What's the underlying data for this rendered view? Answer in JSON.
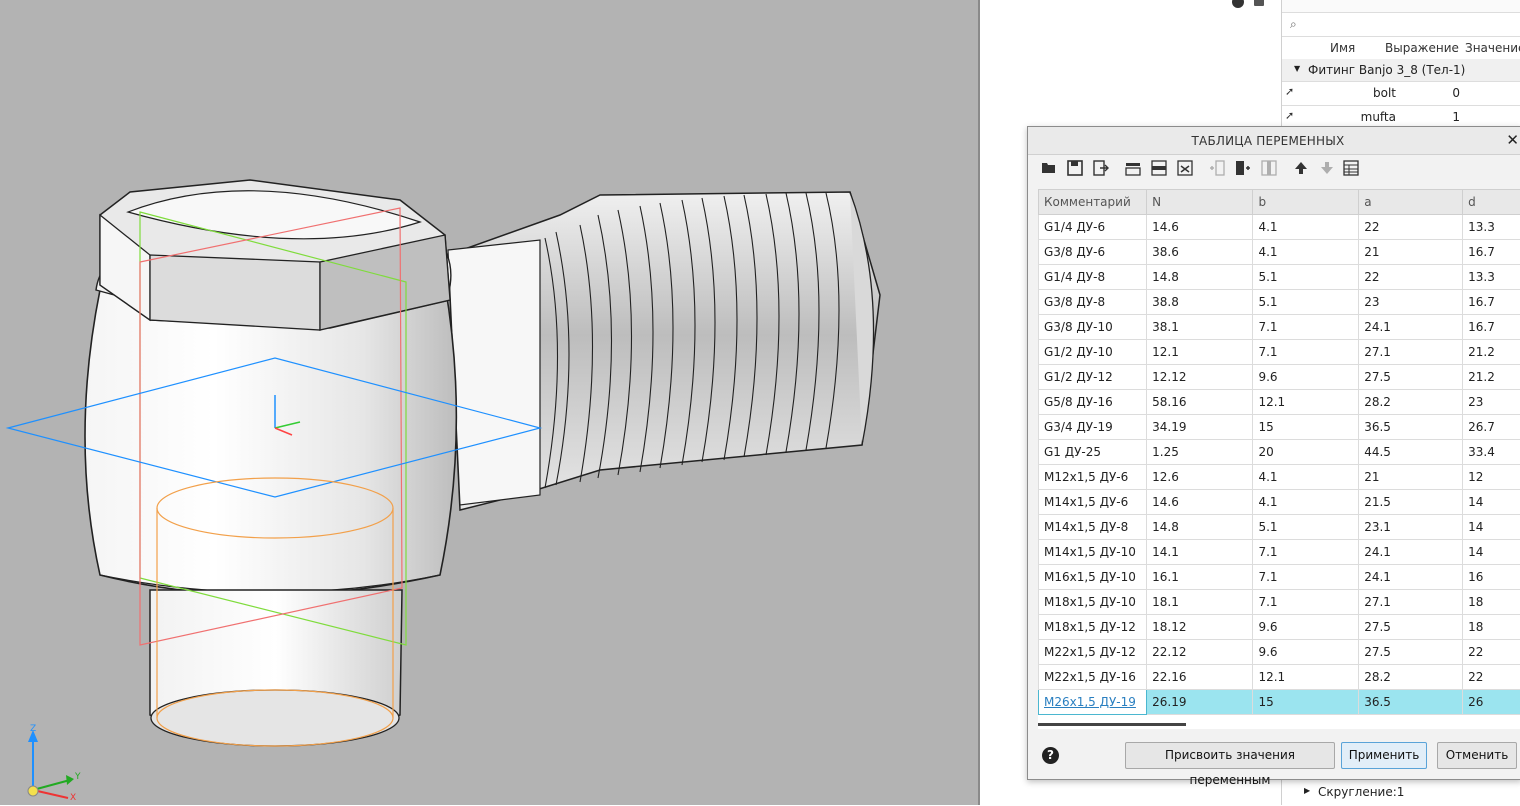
{
  "varpanel": {
    "columns": [
      "Имя",
      "Выражение",
      "Значение"
    ],
    "group": "Фитинг Banjo 3_8 (Тел-1)",
    "rows": [
      {
        "name": "bolt",
        "value": "0"
      },
      {
        "name": "mufta",
        "value": "1"
      }
    ],
    "footer_item": "Скругление:1",
    "search_icon": "search-icon"
  },
  "dialog": {
    "title": "ТАБЛИЦА ПЕРЕМЕННЫХ",
    "close": "✕",
    "help": "?",
    "buttons": {
      "assign": "Присвоить значения переменным",
      "apply": "Применить",
      "cancel": "Отменить"
    },
    "toolbar_icons": [
      "open-icon",
      "save-icon",
      "export-icon",
      "insert-row-above-icon",
      "insert-row-icon",
      "delete-row-icon",
      "insert-column-before-icon",
      "insert-column-after-icon",
      "delete-column-icon",
      "move-up-icon",
      "move-down-icon",
      "table-settings-icon"
    ],
    "columns": [
      "Комментарий",
      "N",
      "b",
      "a",
      "d"
    ],
    "rows": [
      [
        "G1/4 ДУ-6",
        "14.6",
        "4.1",
        "22",
        "13.3"
      ],
      [
        "G3/8 ДУ-6",
        "38.6",
        "4.1",
        "21",
        "16.7"
      ],
      [
        "G1/4 ДУ-8",
        "14.8",
        "5.1",
        "22",
        "13.3"
      ],
      [
        "G3/8 ДУ-8",
        "38.8",
        "5.1",
        "23",
        "16.7"
      ],
      [
        "G3/8 ДУ-10",
        "38.1",
        "7.1",
        "24.1",
        "16.7"
      ],
      [
        "G1/2 ДУ-10",
        "12.1",
        "7.1",
        "27.1",
        "21.2"
      ],
      [
        "G1/2 ДУ-12",
        "12.12",
        "9.6",
        "27.5",
        "21.2"
      ],
      [
        "G5/8 ДУ-16",
        "58.16",
        "12.1",
        "28.2",
        "23"
      ],
      [
        "G3/4 ДУ-19",
        "34.19",
        "15",
        "36.5",
        "26.7"
      ],
      [
        "G1 ДУ-25",
        "1.25",
        "20",
        "44.5",
        "33.4"
      ],
      [
        "M12x1,5 ДУ-6",
        "12.6",
        "4.1",
        "21",
        "12"
      ],
      [
        "M14x1,5 ДУ-6",
        "14.6",
        "4.1",
        "21.5",
        "14"
      ],
      [
        "M14x1,5 ДУ-8",
        "14.8",
        "5.1",
        "23.1",
        "14"
      ],
      [
        "M14x1,5 ДУ-10",
        "14.1",
        "7.1",
        "24.1",
        "14"
      ],
      [
        "M16x1,5 ДУ-10",
        "16.1",
        "7.1",
        "24.1",
        "16"
      ],
      [
        "M18x1,5 ДУ-10",
        "18.1",
        "7.1",
        "27.1",
        "18"
      ],
      [
        "M18x1,5 ДУ-12",
        "18.12",
        "9.6",
        "27.5",
        "18"
      ],
      [
        "M22x1,5 ДУ-12",
        "22.12",
        "9.6",
        "27.5",
        "22"
      ],
      [
        "M22x1,5 ДУ-16",
        "22.16",
        "12.1",
        "28.2",
        "22"
      ],
      [
        "M26x1,5 ДУ-19",
        "26.19",
        "15",
        "36.5",
        "26"
      ]
    ],
    "selected_row": 19
  },
  "axes": {
    "z": "Z",
    "y": "Y",
    "x": "X"
  },
  "colors": {
    "viewport_bg": "#b3b3b3",
    "selection": "#9be4ef",
    "plane_blue": "#1e90ff",
    "plane_red": "#f07070",
    "plane_green": "#7fdc3c",
    "sketch_orange": "#f2a04a"
  }
}
